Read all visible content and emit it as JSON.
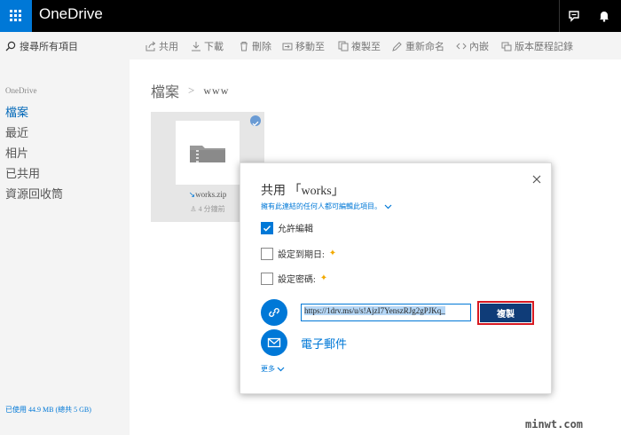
{
  "header": {
    "app_title": "OneDrive",
    "accent_color": "#0078d7",
    "icons": [
      "waffle-icon",
      "chat-icon",
      "bell-icon"
    ]
  },
  "sidebar": {
    "search_placeholder": "搜尋所有項目",
    "section_label": "OneDrive",
    "items": [
      {
        "label": "檔案",
        "active": true
      },
      {
        "label": "最近",
        "active": false
      },
      {
        "label": "相片",
        "active": false
      },
      {
        "label": "已共用",
        "active": false
      },
      {
        "label": "資源回收筒",
        "active": false
      }
    ],
    "quota": "已使用 44.9 MB (總共 5 GB)"
  },
  "commands": {
    "share": "共用",
    "download": "下載",
    "delete": "刪除",
    "move": "移動至",
    "copy": "複製至",
    "rename": "重新命名",
    "embed": "內嵌",
    "history": "版本歷程記錄"
  },
  "breadcrumb": {
    "root": "檔案",
    "current": "www"
  },
  "file_tile": {
    "name": "works.zip",
    "meta": "4 分鐘前"
  },
  "share_dialog": {
    "title": "共用 「works」",
    "permission_text": "擁有此連結的任何人都可編輯此項目。",
    "options": [
      {
        "label": "允許編輯",
        "checked": true,
        "premium": false
      },
      {
        "label": "設定到期日:",
        "checked": false,
        "premium": true
      },
      {
        "label": "設定密碼:",
        "checked": false,
        "premium": true
      }
    ],
    "premium_mark": "✦",
    "link_url": "https://1drv.ms/u/s!AjzI7YenszRJg2gPJKq_",
    "copy_label": "複製",
    "email_label": "電子郵件",
    "more_label": "更多"
  },
  "watermark": "minwt.com"
}
